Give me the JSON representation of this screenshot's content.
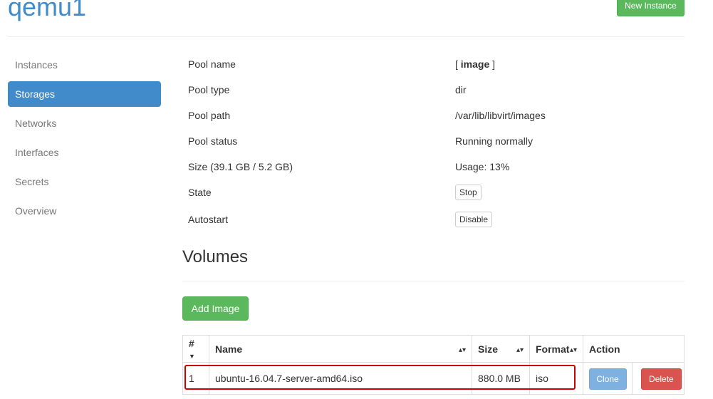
{
  "header": {
    "title": "qemu1",
    "new_instance_label": "New Instance"
  },
  "sidebar": {
    "items": [
      {
        "label": "Instances",
        "active": false
      },
      {
        "label": "Storages",
        "active": true
      },
      {
        "label": "Networks",
        "active": false
      },
      {
        "label": "Interfaces",
        "active": false
      },
      {
        "label": "Secrets",
        "active": false
      },
      {
        "label": "Overview",
        "active": false
      }
    ]
  },
  "pool": {
    "name_label": "Pool name",
    "name_open": "[ ",
    "name_value": "image",
    "name_close": " ]",
    "type_label": "Pool type",
    "type_value": "dir",
    "path_label": "Pool path",
    "path_value": "/var/lib/libvirt/images",
    "status_label": "Pool status",
    "status_value": "Running normally",
    "size_label": "Size (39.1 GB / 5.2 GB)",
    "usage_value": "Usage: 13%",
    "state_label": "State",
    "state_button": "Stop",
    "autostart_label": "Autostart",
    "autostart_button": "Disable"
  },
  "volumes": {
    "title": "Volumes",
    "add_button": "Add Image",
    "columns": {
      "num": "#",
      "name": "Name",
      "size": "Size",
      "format": "Format",
      "action": "Action"
    },
    "rows": [
      {
        "num": "1",
        "name": "ubuntu-16.04.7-server-amd64.iso",
        "size": "880.0 MB",
        "format": "iso",
        "clone": "Clone",
        "delete": "Delete"
      }
    ]
  },
  "colors": {
    "primary": "#428bca",
    "success": "#5cb85c",
    "danger": "#d9534f",
    "highlight": "#cc0000"
  }
}
